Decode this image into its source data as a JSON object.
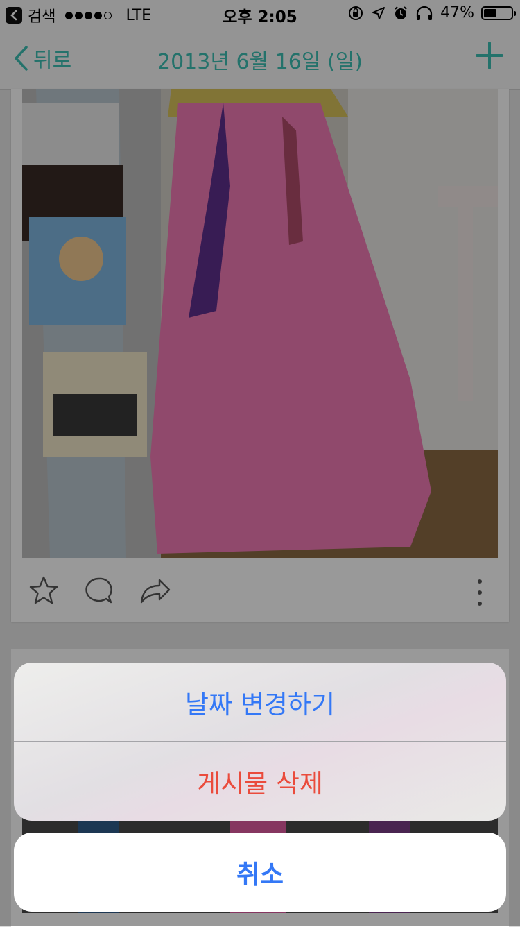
{
  "status_bar": {
    "back_app": "검색",
    "carrier": "LTE",
    "time": "오후 2:05",
    "battery": "47%",
    "battery_level": 0.47
  },
  "nav": {
    "back_label": "뒤로",
    "title": "2013년 6월 16일 (일)"
  },
  "colors": {
    "accent": "#3dbfb2",
    "action_blue": "#3478f6",
    "destructive_red": "#ea4b3c"
  },
  "action_sheet": {
    "change_date": "날짜 변경하기",
    "delete_post": "게시물 삭제",
    "cancel": "취소"
  }
}
